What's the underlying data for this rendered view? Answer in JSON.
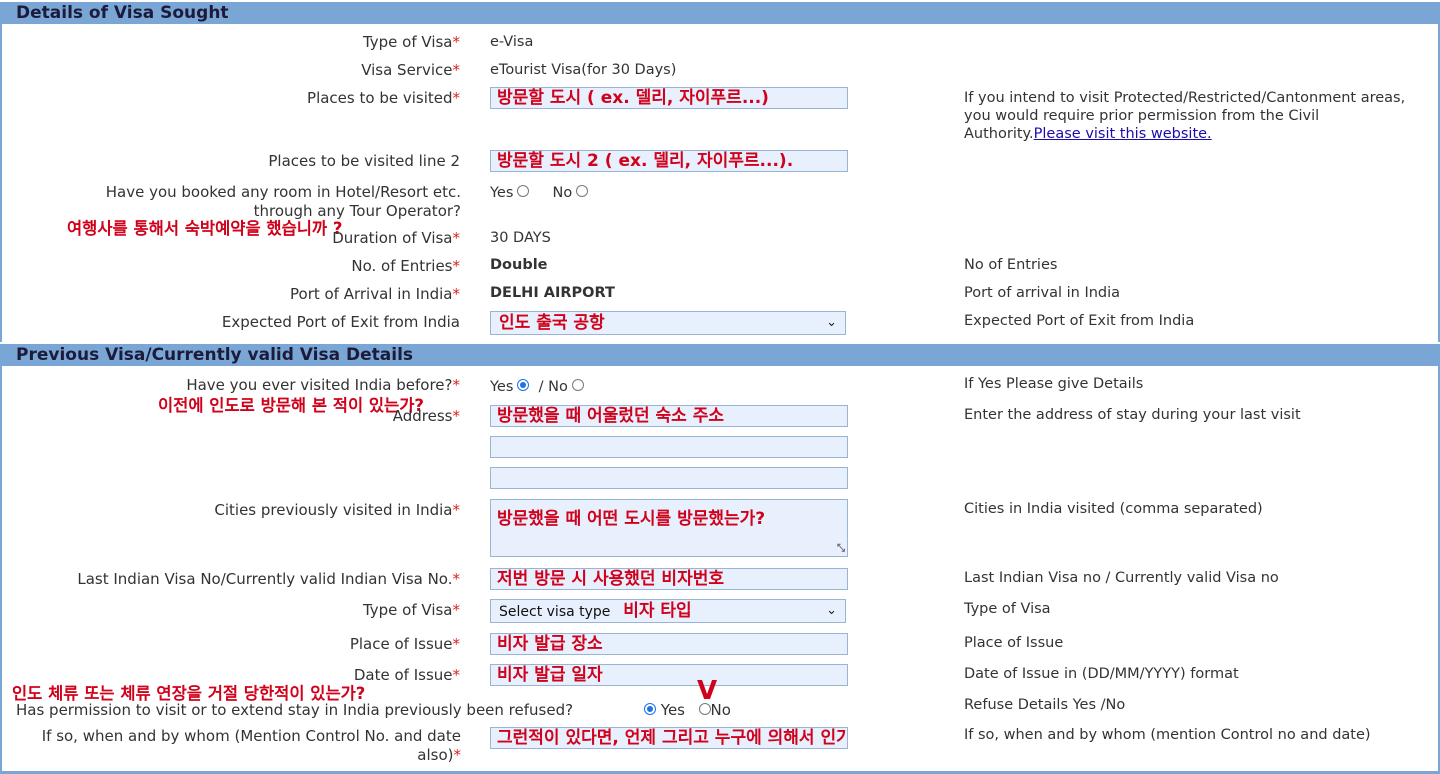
{
  "section1": {
    "title": "Details of Visa Sought"
  },
  "section2": {
    "title": "Previous Visa/Currently valid Visa Details"
  },
  "required_mark": "*",
  "fields": {
    "type_of_visa": {
      "label": "Type of Visa",
      "value": "e-Visa"
    },
    "visa_service": {
      "label": "Visa Service",
      "value": "eTourist Visa(for 30 Days)"
    },
    "places": {
      "label": "Places to be visited",
      "value": "방문할 도시 ( ex. 델리, 자이푸르...)",
      "hint": "If you intend to visit Protected/Restricted/Cantonment areas, you would require prior permission from the Civil Authority.",
      "hint_link": "Please visit this website."
    },
    "places2": {
      "label": "Places to be visited line 2",
      "value": "방문할 도시 2 ( ex. 델리, 자이푸르...)."
    },
    "hotel_booked": {
      "label": "Have you booked any room in Hotel/Resort etc. through any Tour Operator?",
      "yes": "Yes",
      "no": "No"
    },
    "duration": {
      "label": "Duration of Visa",
      "value": "30 DAYS"
    },
    "entries": {
      "label": "No. of Entries",
      "value": "Double",
      "hint": "No of Entries"
    },
    "port_arrival": {
      "label": "Port of Arrival in India",
      "value": "DELHI AIRPORT",
      "hint": "Port of arrival in India"
    },
    "port_exit": {
      "label": "Expected Port of Exit from India",
      "value": "인도 출국 공항",
      "hint": "Expected Port of Exit from India"
    },
    "visited_before": {
      "label": "Have you ever visited India before?",
      "yes": "Yes",
      "sep": "/ No",
      "hint": "If Yes Please give Details"
    },
    "address": {
      "label": "Address",
      "value": "방문했을 때 어울렀던 숙소 주소",
      "hint": "Enter the address of stay during your last visit"
    },
    "cities": {
      "label": "Cities previously visited in India",
      "value": "방문했을 때 어떤 도시를 방문했는가?",
      "hint": "Cities in India visited (comma separated)"
    },
    "last_visa": {
      "label": "Last Indian Visa No/Currently valid Indian Visa No.",
      "value": "저번 방문 시 사용했던 비자번호",
      "hint": "Last Indian Visa no / Currently valid Visa no"
    },
    "prev_type": {
      "label": "Type of Visa",
      "placeholder": "Select visa type",
      "value": "비자 타입",
      "hint": "Type of Visa"
    },
    "place_issue": {
      "label": "Place of Issue",
      "value": "비자 발급 장소",
      "hint": "Place of Issue"
    },
    "date_issue": {
      "label": "Date of Issue",
      "value": "비자 발급 일자",
      "hint": "Date of Issue in (DD/MM/YYYY) format"
    },
    "refused": {
      "label": "Has permission to visit or to extend stay in India previously been refused?",
      "yes": "Yes",
      "no": "No",
      "hint": "Refuse Details Yes /No"
    },
    "refused_details": {
      "label": "If so, when and by whom (Mention Control No. and date also)",
      "value": "그런적이 있다면, 언제 그리고 누구에 의해서 인가요?",
      "hint": "If so, when and by whom (mention Control no and date)"
    }
  },
  "annotations": {
    "hotel_note": "여행사를 통해서 숙박예약을 했습니까 ?",
    "visited_note": "이전에 인도로 방문해 본 적이 있는가?",
    "refused_note": "인도 체류 또는 체류 연장을 거절 당한적이 있는가?",
    "check_mark": "V"
  },
  "colors": {
    "header": "#7aa6d6",
    "required": "#e02020",
    "annotation": "#d0021b",
    "input_bg": "#e8f0fe",
    "link": "#1a0dab"
  }
}
